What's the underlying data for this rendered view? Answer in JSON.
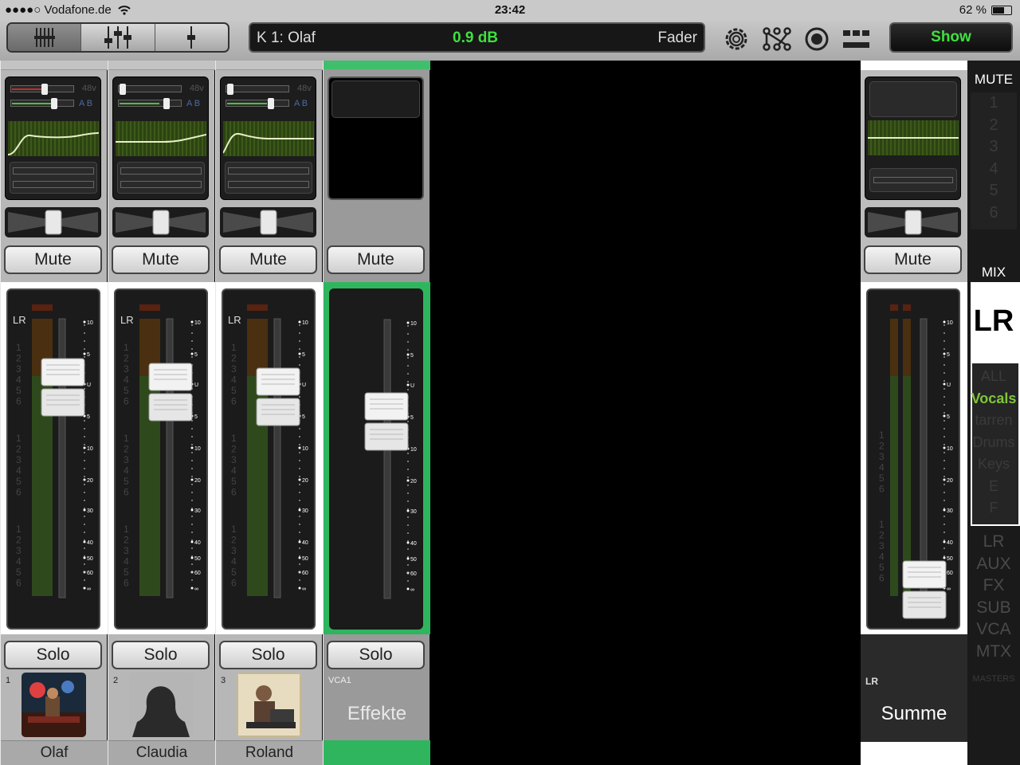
{
  "status": {
    "carrier": "●●●●○ Vodafone.de",
    "time": "23:42",
    "battery": "62 %"
  },
  "toolbar": {
    "channel_label": "K 1: Olaf",
    "channel_value": "0.9 dB",
    "channel_mode": "Fader",
    "show_label": "Show",
    "accent": "#3fe03f"
  },
  "strips": [
    {
      "number": "1",
      "name": "Olaf",
      "mute": "Mute",
      "solo": "Solo",
      "meter_label": "LR"
    },
    {
      "number": "2",
      "name": "Claudia",
      "mute": "Mute",
      "solo": "Solo",
      "meter_label": "LR"
    },
    {
      "number": "3",
      "name": "Roland",
      "mute": "Mute",
      "solo": "Solo",
      "meter_label": "LR"
    }
  ],
  "vca": {
    "number": "VCA1",
    "name": "Effekte",
    "mute": "Mute",
    "solo": "Solo"
  },
  "master": {
    "mute": "Mute",
    "label": "LR",
    "name": "Summe"
  },
  "meter": {
    "phantom": "48v",
    "ab": "A B",
    "scale": [
      "10",
      "5",
      "U",
      "5",
      "10",
      "20",
      "30",
      "40",
      "50",
      "60",
      "∞"
    ],
    "groups": [
      "1",
      "2",
      "3",
      "4",
      "5",
      "6"
    ]
  },
  "right_panel": {
    "mute_title": "MUTE",
    "mute_groups": [
      "1",
      "2",
      "3",
      "4",
      "5",
      "6"
    ],
    "mix_title": "MIX",
    "mix_selected": "LR",
    "views": [
      "ALL",
      "Vocals",
      "tarren",
      "Drums",
      "Keys",
      "E",
      "F"
    ],
    "active_view": "Vocals",
    "masters": [
      "LR",
      "AUX",
      "FX",
      "SUB",
      "VCA",
      "MTX"
    ],
    "masters_title": "MASTERS"
  }
}
